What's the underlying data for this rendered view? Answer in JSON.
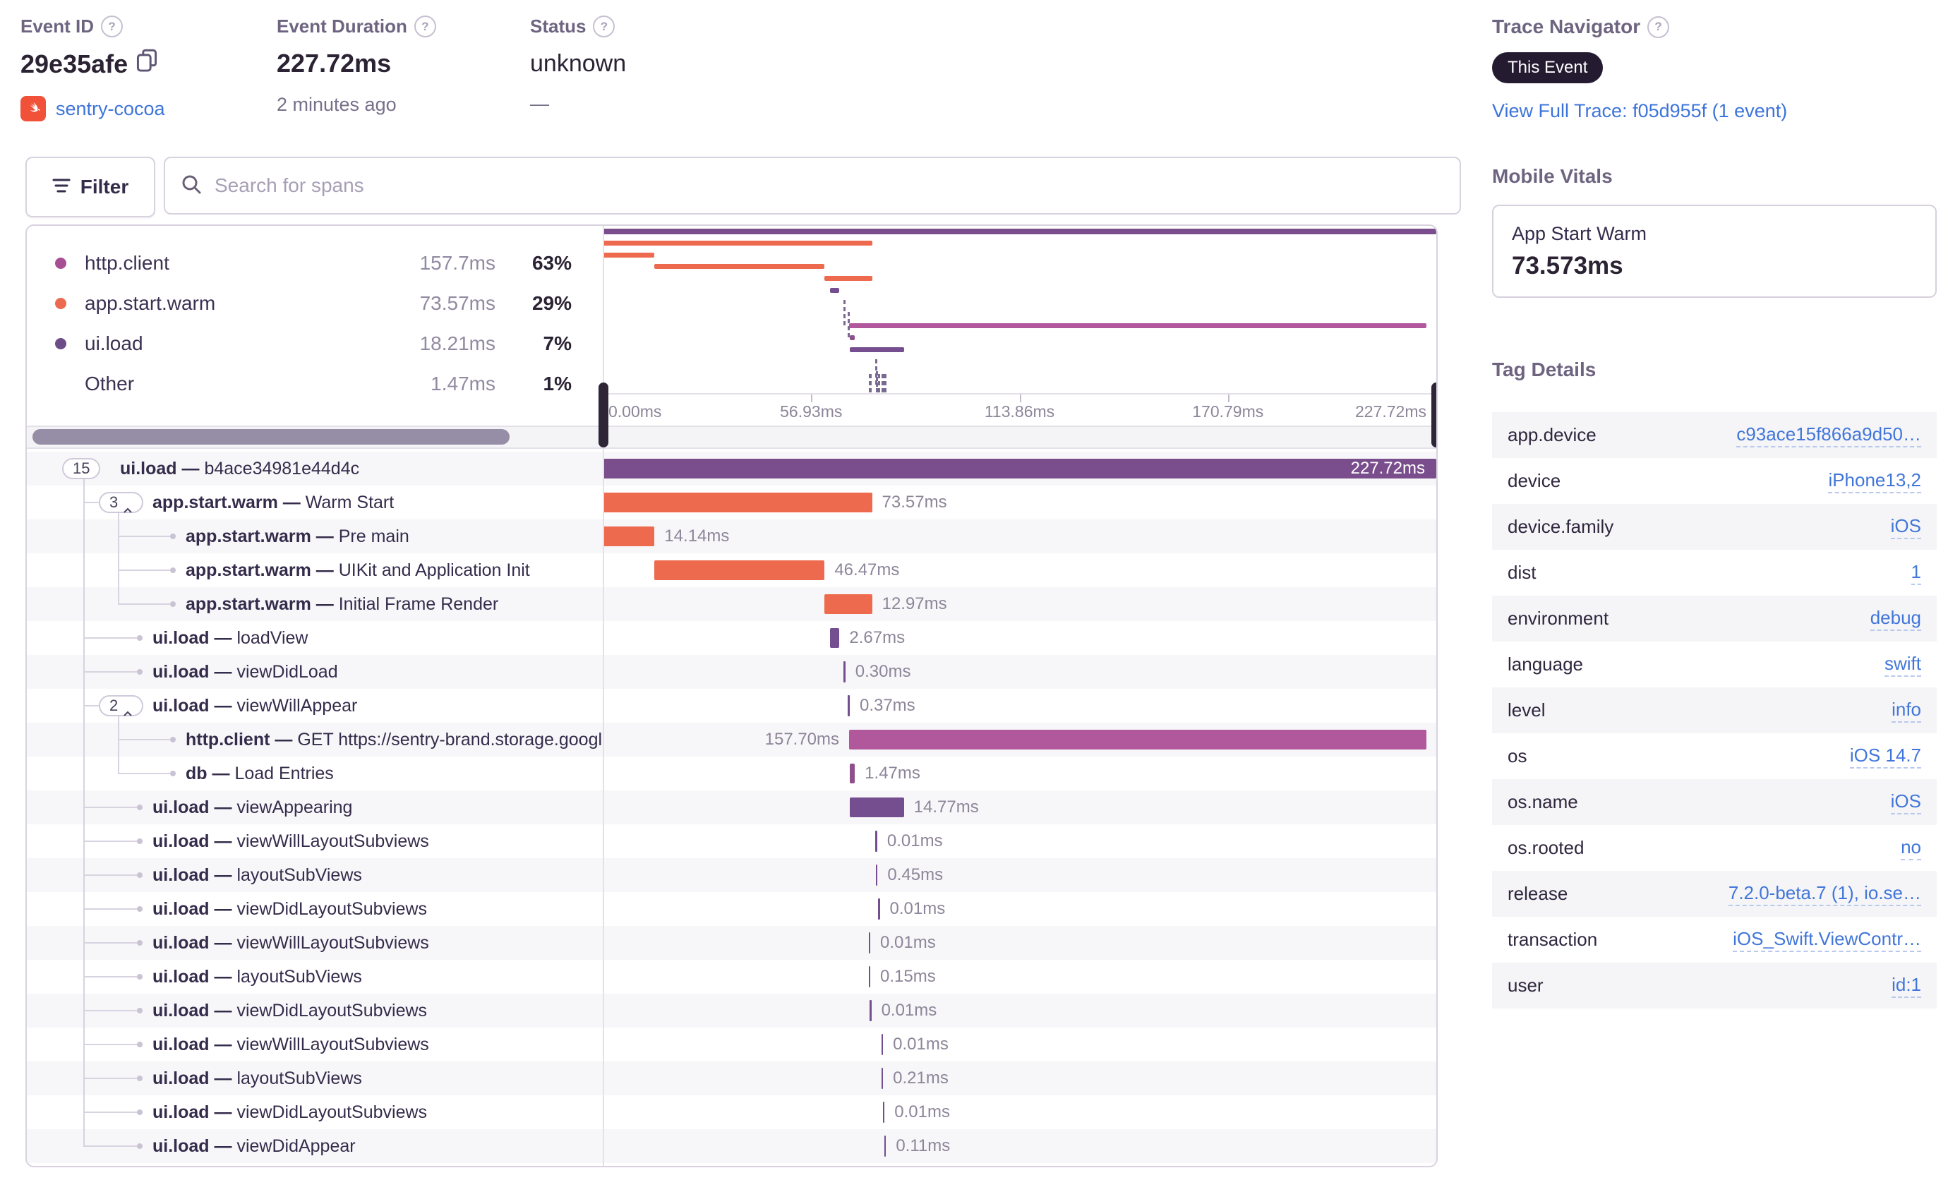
{
  "header": {
    "event_id": {
      "label": "Event ID",
      "value": "29e35afe",
      "project": "sentry-cocoa"
    },
    "event_duration": {
      "label": "Event Duration",
      "value": "227.72ms",
      "subtext": "2 minutes ago"
    },
    "status": {
      "label": "Status",
      "value": "unknown",
      "subtext": "—"
    }
  },
  "trace_navigator": {
    "label": "Trace Navigator",
    "badge": "This Event",
    "link": "View Full Trace: f05d955f (1 event)"
  },
  "filter_bar": {
    "filter_label": "Filter",
    "search_placeholder": "Search for spans"
  },
  "legend": {
    "items": [
      {
        "op": "http.client",
        "duration": "157.7ms",
        "pct": "63%",
        "dot": "#a84e95"
      },
      {
        "op": "app.start.warm",
        "duration": "73.57ms",
        "pct": "29%",
        "dot": "#ec6a4f"
      },
      {
        "op": "ui.load",
        "duration": "18.21ms",
        "pct": "7%",
        "dot": "#6c4d87"
      },
      {
        "op": "Other",
        "duration": "1.47ms",
        "pct": "1%",
        "dot": ""
      }
    ]
  },
  "minimap": {
    "axis_ticks": [
      "0.00ms",
      "56.93ms",
      "113.86ms",
      "170.79ms",
      "227.72ms"
    ],
    "total_ms": 227.72
  },
  "mobile_vitals": {
    "title": "Mobile Vitals",
    "card_title": "App Start Warm",
    "card_value": "73.573ms"
  },
  "tag_details": {
    "title": "Tag Details",
    "rows": [
      {
        "key": "app.device",
        "value": "c93ace15f866a9d50…"
      },
      {
        "key": "device",
        "value": "iPhone13,2"
      },
      {
        "key": "device.family",
        "value": "iOS"
      },
      {
        "key": "dist",
        "value": "1"
      },
      {
        "key": "environment",
        "value": "debug"
      },
      {
        "key": "language",
        "value": "swift"
      },
      {
        "key": "level",
        "value": "info"
      },
      {
        "key": "os",
        "value": "iOS 14.7"
      },
      {
        "key": "os.name",
        "value": "iOS"
      },
      {
        "key": "os.rooted",
        "value": "no"
      },
      {
        "key": "release",
        "value": "7.2.0-beta.7 (1), io.se…"
      },
      {
        "key": "transaction",
        "value": "iOS_Swift.ViewContr…"
      },
      {
        "key": "user",
        "value": "id:1"
      }
    ]
  },
  "spans": [
    {
      "op": "ui.load —",
      "desc": "b4ace34981e44d4c",
      "badge": "15",
      "chevron": false,
      "level": 0,
      "start_ms": 0,
      "dur_ms": 227.72,
      "dur_label": "227.72ms",
      "cat": "root",
      "label_pos": "inside"
    },
    {
      "op": "app.start.warm —",
      "desc": "Warm Start",
      "badge": "3",
      "chevron": true,
      "level": 1,
      "start_ms": 0,
      "dur_ms": 73.57,
      "dur_label": "73.57ms",
      "cat": "app.start.warm",
      "label_pos": "right"
    },
    {
      "op": "app.start.warm —",
      "desc": "Pre main",
      "badge": "",
      "chevron": false,
      "level": 2,
      "start_ms": 0,
      "dur_ms": 14.14,
      "dur_label": "14.14ms",
      "cat": "app.start.warm",
      "label_pos": "right"
    },
    {
      "op": "app.start.warm —",
      "desc": "UIKit and Application Init",
      "badge": "",
      "chevron": false,
      "level": 2,
      "start_ms": 14.14,
      "dur_ms": 46.47,
      "dur_label": "46.47ms",
      "cat": "app.start.warm",
      "label_pos": "right"
    },
    {
      "op": "app.start.warm —",
      "desc": "Initial Frame Render",
      "badge": "",
      "chevron": false,
      "level": 2,
      "start_ms": 60.61,
      "dur_ms": 12.97,
      "dur_label": "12.97ms",
      "cat": "app.start.warm",
      "label_pos": "right"
    },
    {
      "op": "ui.load —",
      "desc": "loadView",
      "badge": "",
      "chevron": false,
      "level": 1,
      "start_ms": 62.0,
      "dur_ms": 2.67,
      "dur_label": "2.67ms",
      "cat": "ui.load",
      "label_pos": "right"
    },
    {
      "op": "ui.load —",
      "desc": "viewDidLoad",
      "badge": "",
      "chevron": false,
      "level": 1,
      "start_ms": 65.8,
      "dur_ms": 0.3,
      "dur_label": "0.30ms",
      "cat": "ui.load",
      "label_pos": "right"
    },
    {
      "op": "ui.load —",
      "desc": "viewWillAppear",
      "badge": "2",
      "chevron": true,
      "level": 1,
      "start_ms": 67.0,
      "dur_ms": 0.37,
      "dur_label": "0.37ms",
      "cat": "ui.load",
      "label_pos": "right"
    },
    {
      "op": "http.client —",
      "desc": "GET https://sentry-brand.storage.googleapis.com",
      "badge": "",
      "chevron": false,
      "level": 2,
      "start_ms": 67.3,
      "dur_ms": 157.7,
      "dur_label": "157.70ms",
      "cat": "http.client",
      "label_pos": "left"
    },
    {
      "op": "db —",
      "desc": "Load Entries",
      "badge": "",
      "chevron": false,
      "level": 2,
      "start_ms": 67.4,
      "dur_ms": 1.47,
      "dur_label": "1.47ms",
      "cat": "db",
      "label_pos": "right"
    },
    {
      "op": "ui.load —",
      "desc": "viewAppearing",
      "badge": "",
      "chevron": false,
      "level": 1,
      "start_ms": 67.5,
      "dur_ms": 14.77,
      "dur_label": "14.77ms",
      "cat": "ui.load",
      "label_pos": "right"
    },
    {
      "op": "ui.load —",
      "desc": "viewWillLayoutSubviews",
      "badge": "",
      "chevron": false,
      "level": 1,
      "start_ms": 74.5,
      "dur_ms": 0.01,
      "dur_label": "0.01ms",
      "cat": "ui.load",
      "label_pos": "right"
    },
    {
      "op": "ui.load —",
      "desc": "layoutSubViews",
      "badge": "",
      "chevron": false,
      "level": 1,
      "start_ms": 74.6,
      "dur_ms": 0.45,
      "dur_label": "0.45ms",
      "cat": "ui.load",
      "label_pos": "right"
    },
    {
      "op": "ui.load —",
      "desc": "viewDidLayoutSubviews",
      "badge": "",
      "chevron": false,
      "level": 1,
      "start_ms": 75.2,
      "dur_ms": 0.01,
      "dur_label": "0.01ms",
      "cat": "ui.load",
      "label_pos": "right"
    },
    {
      "op": "ui.load —",
      "desc": "viewWillLayoutSubviews",
      "badge": "",
      "chevron": false,
      "level": 1,
      "start_ms": 72.6,
      "dur_ms": 0.01,
      "dur_label": "0.01ms",
      "cat": "ui.load",
      "label_pos": "right"
    },
    {
      "op": "ui.load —",
      "desc": "layoutSubViews",
      "badge": "",
      "chevron": false,
      "level": 1,
      "start_ms": 72.6,
      "dur_ms": 0.15,
      "dur_label": "0.15ms",
      "cat": "ui.load",
      "label_pos": "right"
    },
    {
      "op": "ui.load —",
      "desc": "viewDidLayoutSubviews",
      "badge": "",
      "chevron": false,
      "level": 1,
      "start_ms": 72.9,
      "dur_ms": 0.01,
      "dur_label": "0.01ms",
      "cat": "ui.load",
      "label_pos": "right"
    },
    {
      "op": "ui.load —",
      "desc": "viewWillLayoutSubviews",
      "badge": "",
      "chevron": false,
      "level": 1,
      "start_ms": 76.1,
      "dur_ms": 0.01,
      "dur_label": "0.01ms",
      "cat": "ui.load",
      "label_pos": "right"
    },
    {
      "op": "ui.load —",
      "desc": "layoutSubViews",
      "badge": "",
      "chevron": false,
      "level": 1,
      "start_ms": 76.1,
      "dur_ms": 0.21,
      "dur_label": "0.21ms",
      "cat": "ui.load",
      "label_pos": "right"
    },
    {
      "op": "ui.load —",
      "desc": "viewDidLayoutSubviews",
      "badge": "",
      "chevron": false,
      "level": 1,
      "start_ms": 76.5,
      "dur_ms": 0.01,
      "dur_label": "0.01ms",
      "cat": "ui.load",
      "label_pos": "right"
    },
    {
      "op": "ui.load —",
      "desc": "viewDidAppear",
      "badge": "",
      "chevron": false,
      "level": 1,
      "start_ms": 76.9,
      "dur_ms": 0.11,
      "dur_label": "0.11ms",
      "cat": "ui.load",
      "label_pos": "right"
    }
  ],
  "colors": {
    "root": "#7a4e8c",
    "ui.load": "#744e8f",
    "app.start.warm": "#ee6a4e",
    "http.client": "#b1589c",
    "db": "#8f4f8a",
    "accent_blue": "#3d74db",
    "swift_orange": "#f05138"
  }
}
